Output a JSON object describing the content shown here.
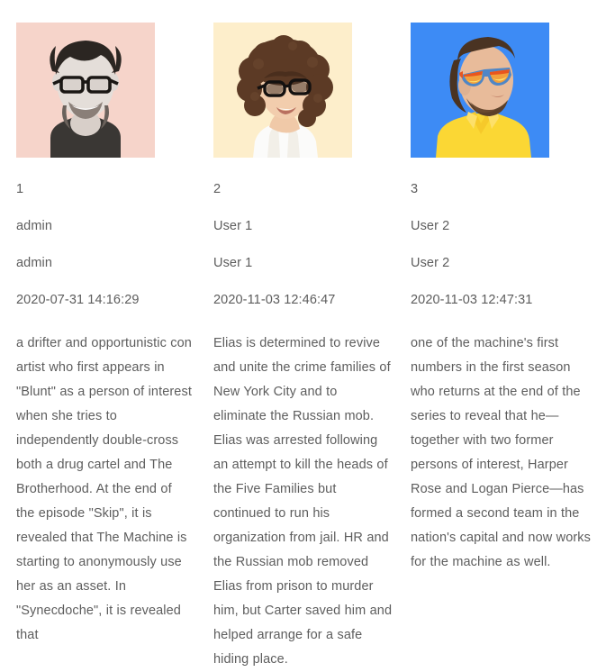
{
  "records": [
    {
      "id": "1",
      "user": "admin",
      "name": "admin",
      "date": "2020-07-31 14:16:29",
      "description": "a drifter and opportunistic con artist who first appears in \"Blunt\" as a person of interest when she tries to independently double-cross both a drug cartel and The Brotherhood. At the end of the episode \"Skip\", it is revealed that The Machine is starting to anonymously use her as an asset. In \"Synecdoche\", it is revealed that",
      "photo": {
        "alt": "smiling bearded man with black glasses in dark t-shirt",
        "background": "#f6d4ca",
        "skin": "#e8e3e0",
        "hair": "#2b2622",
        "shirt": "#3a3734",
        "glasses": "#1a1714"
      }
    },
    {
      "id": "2",
      "user": "User 1",
      "name": "User 1",
      "date": "2020-11-03 12:46:47",
      "description": "Elias is determined to revive and unite the crime families of New York City and to eliminate the Russian mob. Elias was arrested following an attempt to kill the heads of the Five Families but continued to run his organization from jail. HR and the Russian mob removed Elias from prison to murder him, but Carter saved him and helped arrange for a safe hiding place.",
      "photo": {
        "alt": "smiling woman with curly afro hair and black glasses in white top",
        "background": "#fdeecb",
        "skin": "#f0c9a8",
        "hair": "#5c3a25",
        "shirt": "#fbfbfa",
        "glasses": "#141110"
      }
    },
    {
      "id": "3",
      "user": "User 2",
      "name": "User 2",
      "date": "2020-11-03 12:47:31",
      "description": "one of the machine's first numbers in the first season who returns at the end of the series to reveal that he—together with two former persons of interest, Harper Rose and Logan Pierce—has formed a second team in the nation's capital and now works for the machine as well.",
      "photo": {
        "alt": "bearded man with mirrored sunglasses in yellow polo shirt",
        "background": "#3d8bf5",
        "skin": "#e8bb9a",
        "hair": "#4a3322",
        "shirt": "#fbd734",
        "glasses": "#e8561e"
      }
    }
  ]
}
